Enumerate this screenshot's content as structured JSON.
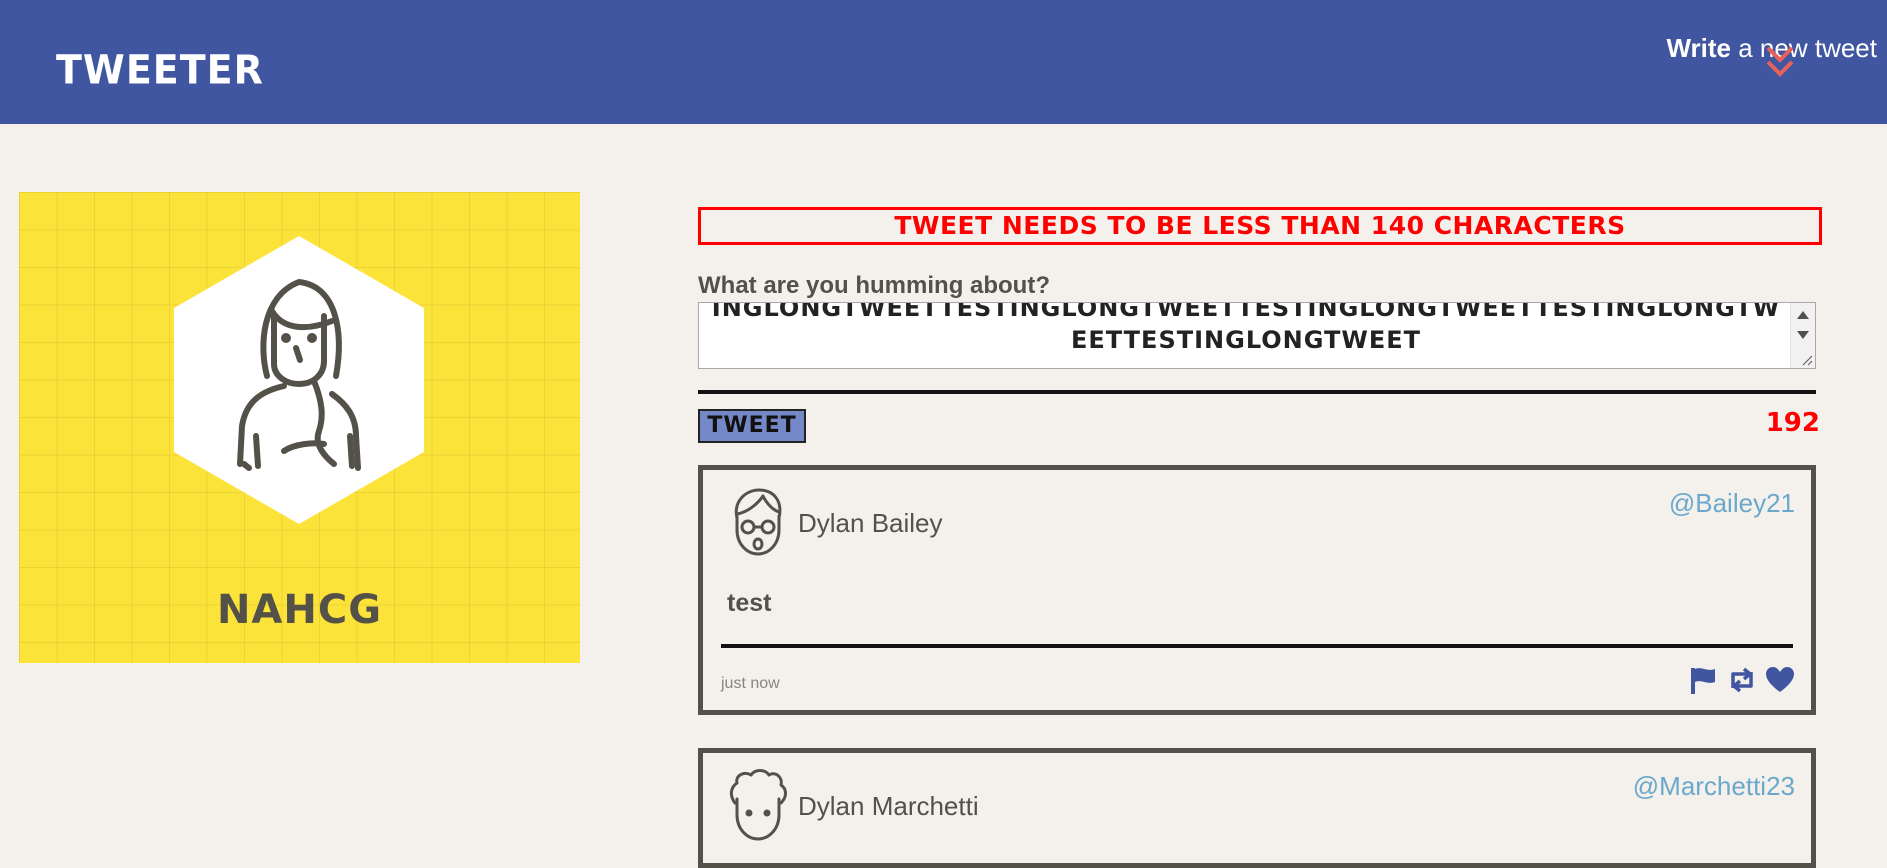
{
  "nav": {
    "brand": "TWEETER",
    "write_strong": "Write",
    "write_rest": " a new tweet"
  },
  "profile": {
    "handle": "NAHCG",
    "bg_color": "#fbe33a"
  },
  "compose": {
    "error": "TWEET NEEDS TO BE LESS THAN 140 CHARACTERS",
    "label": "What are you humming about?",
    "text": "INGLONGTWEETTESTINGLONGTWEETTESTINGLONGTWEETTESTINGLONGTWEETTESTINGLONGTWEET",
    "submit_label": "TWEET",
    "counter": "192"
  },
  "tweets": [
    {
      "name": "Dylan Bailey",
      "handle": "@Bailey21",
      "content": "test",
      "time": "just now",
      "actions": [
        "flag-icon",
        "retweet-icon",
        "heart-icon"
      ]
    },
    {
      "name": "Dylan Marchetti",
      "handle": "@Marchetti23"
    }
  ],
  "colors": {
    "nav": "#4056a1",
    "accent": "#7488c7",
    "error": "#ff0000",
    "handle": "#6ba8cc",
    "text": "#545149"
  }
}
